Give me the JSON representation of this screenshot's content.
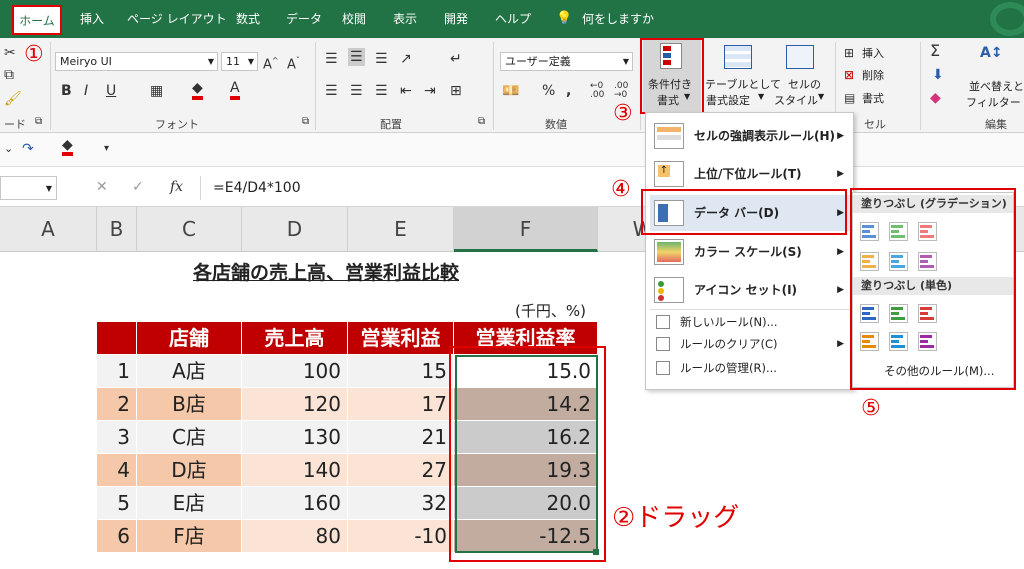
{
  "ribbon_tabs": [
    "ホーム",
    "挿入",
    "ページ レイアウト",
    "数式",
    "データ",
    "校閲",
    "表示",
    "開発",
    "ヘルプ",
    "何をしますか"
  ],
  "font": {
    "name": "Meiryo UI",
    "size": "11"
  },
  "number_format": "ユーザー定義",
  "groups": {
    "clipboard": "ード",
    "font": "フォント",
    "alignment": "配置",
    "number": "数値",
    "cells": "セル",
    "editing": "編集"
  },
  "ribbon_buttons": {
    "conditional_format": [
      "条件付き",
      "書式"
    ],
    "table_format": [
      "テーブルとして",
      "書式設定"
    ],
    "cell_style": [
      "セルの",
      "スタイル"
    ],
    "insert": "挿入",
    "delete": "削除",
    "format": "書式",
    "sort_filter": [
      "並べ替えと",
      "フィルター"
    ]
  },
  "formula_bar": {
    "fx": "fx",
    "formula": "=E4/D4*100"
  },
  "columns": [
    "A",
    "B",
    "C",
    "D",
    "E",
    "F",
    "W"
  ],
  "sheet": {
    "title": "各店舗の売上高、営業利益比較",
    "unit": "(千円、%)",
    "headers": [
      "店舗",
      "売上高",
      "営業利益",
      "営業利益率"
    ],
    "rows": [
      {
        "no": "1",
        "store": "A店",
        "sales": "100",
        "profit": "15",
        "rate": "15.0"
      },
      {
        "no": "2",
        "store": "B店",
        "sales": "120",
        "profit": "17",
        "rate": "14.2"
      },
      {
        "no": "3",
        "store": "C店",
        "sales": "130",
        "profit": "21",
        "rate": "16.2"
      },
      {
        "no": "4",
        "store": "D店",
        "sales": "140",
        "profit": "27",
        "rate": "19.3"
      },
      {
        "no": "5",
        "store": "E店",
        "sales": "160",
        "profit": "32",
        "rate": "20.0"
      },
      {
        "no": "6",
        "store": "F店",
        "sales": "80",
        "profit": "-10",
        "rate": "-12.5"
      }
    ]
  },
  "cf_menu": {
    "items": [
      "セルの強調表示ルール(H)",
      "上位/下位ルール(T)",
      "データ バー(D)",
      "カラー スケール(S)",
      "アイコン セット(I)"
    ],
    "small": [
      "新しいルール(N)...",
      "ルールのクリア(C)",
      "ルールの管理(R)..."
    ]
  },
  "databar_submenu": {
    "gradient": "塗りつぶし (グラデーション)",
    "solid": "塗りつぶし (単色)",
    "more": "その他のルール(M)..."
  },
  "annotations": {
    "s1": "①",
    "s2": "②ドラッグ",
    "s3": "③",
    "s4": "④",
    "s5": "⑤"
  },
  "colors": {
    "excel_green": "#217346",
    "header_red": "#c00000",
    "annotation_red": "#e00000"
  }
}
